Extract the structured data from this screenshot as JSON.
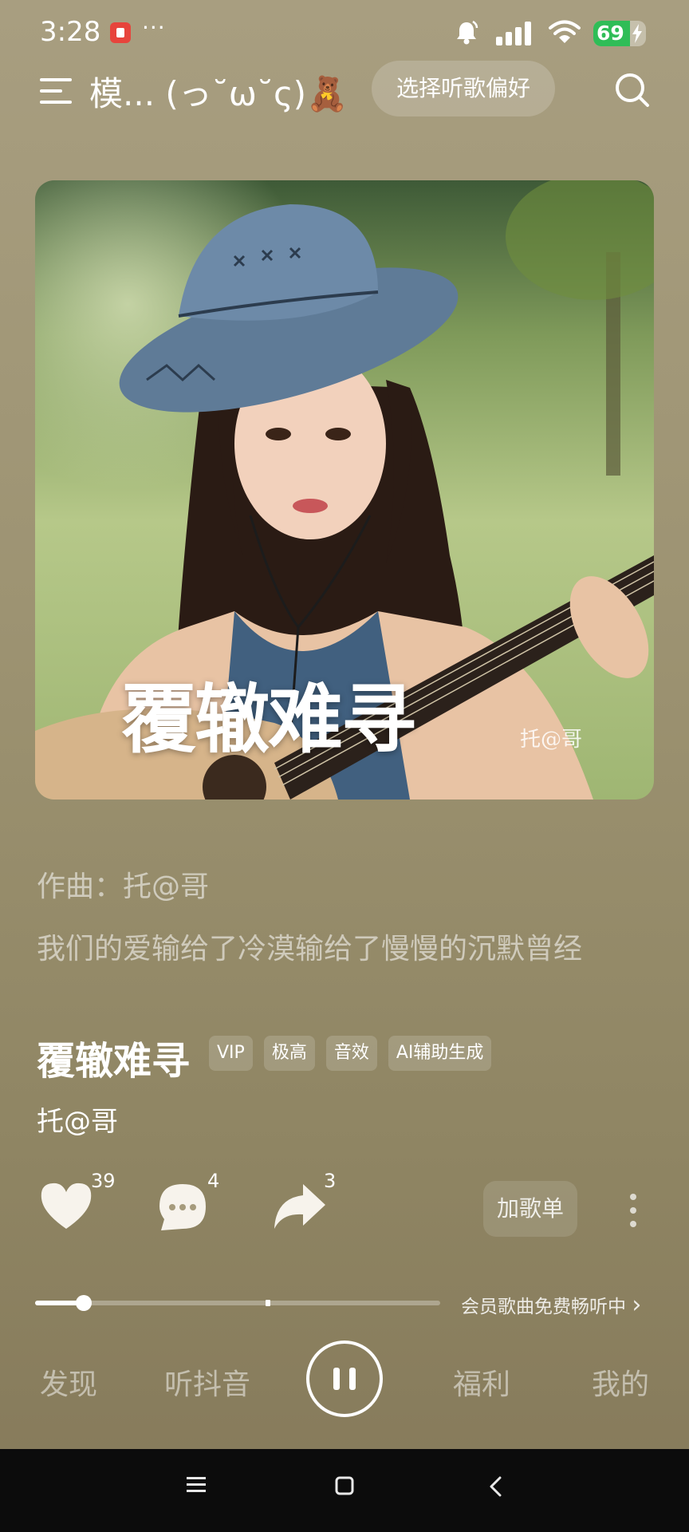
{
  "status_bar": {
    "time": "3:28",
    "more": "···",
    "battery": "69",
    "battery_level": 0.69,
    "icons": [
      "app-notification-icon",
      "bell-icon",
      "signal-icon",
      "wifi-icon",
      "battery-charging-icon"
    ]
  },
  "header": {
    "title": "模... (っ˘ω˘ς)🧸",
    "preference_button": "选择听歌偏好",
    "icons": [
      "menu-icon",
      "search-icon"
    ]
  },
  "album": {
    "cover_title": "覆辙难寻",
    "cover_signature": "托@哥"
  },
  "lyrics": {
    "composer": "作曲：托@哥",
    "line": "我们的爱输给了冷漠输给了慢慢的沉默曾经"
  },
  "song": {
    "title": "覆辙难寻",
    "tags": [
      "VIP",
      "极高",
      "音效",
      "AI辅助生成"
    ],
    "artist": "托@哥"
  },
  "actions": {
    "likes": "39",
    "comments": "4",
    "shares": "3",
    "add_playlist": "加歌单",
    "icons": [
      "heart-icon",
      "comment-icon",
      "share-icon",
      "more-vertical-icon"
    ]
  },
  "progress": {
    "played_fraction": 0.12,
    "buffered_fraction": 0.575,
    "vip_note": "会员歌曲免费畅听中",
    "vip_chevron": "›"
  },
  "bottom_nav": {
    "items": [
      "发现",
      "听抖音",
      "福利",
      "我的"
    ],
    "center_icon": "pause-icon"
  },
  "system_nav": {
    "icons": [
      "menu-lines-icon",
      "home-square-icon",
      "back-chevron-icon"
    ]
  },
  "colors": {
    "background": "#9d9372",
    "accent": "#ffffff",
    "battery_green": "#2fbd57",
    "notification_red": "#e7443c"
  }
}
